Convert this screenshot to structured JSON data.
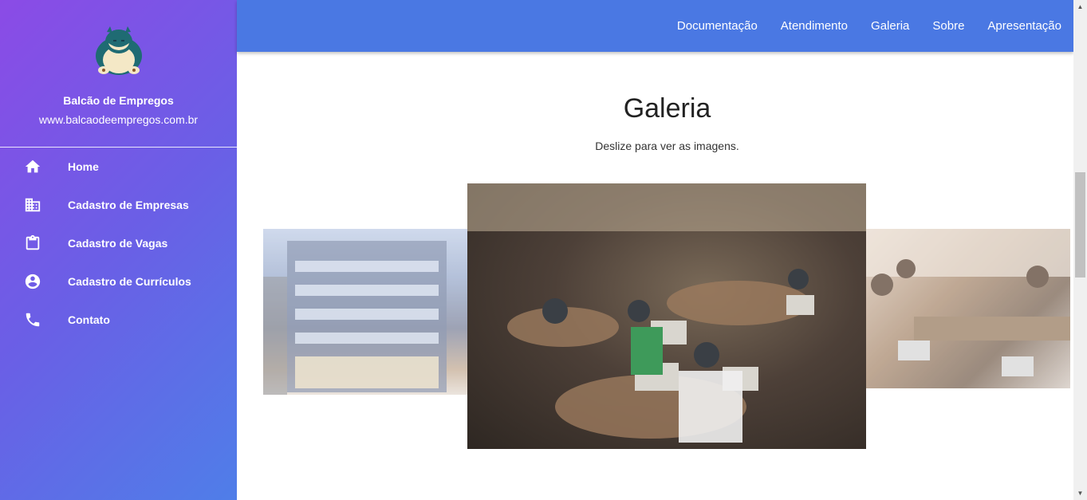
{
  "sidebar": {
    "brand_name": "Balcão de Empregos",
    "brand_url": "www.balcaodeempregos.com.br",
    "logo_icon": "snorlax-logo-icon",
    "items": [
      {
        "label": "Home",
        "icon": "home-icon"
      },
      {
        "label": "Cadastro de Empresas",
        "icon": "business-icon"
      },
      {
        "label": "Cadastro de Vagas",
        "icon": "clipboard-icon"
      },
      {
        "label": "Cadastro de Currículos",
        "icon": "account-circle-icon"
      },
      {
        "label": "Contato",
        "icon": "phone-icon"
      }
    ]
  },
  "topnav": {
    "links": [
      "Documentação",
      "Atendimento",
      "Galeria",
      "Sobre",
      "Apresentação"
    ]
  },
  "gallery": {
    "title": "Galeria",
    "subtitle": "Deslize para ver as imagens."
  },
  "colors": {
    "sidebar_gradient_start": "#8b4be6",
    "sidebar_gradient_end": "#4f7ee8",
    "topbar": "#4a78e3"
  }
}
